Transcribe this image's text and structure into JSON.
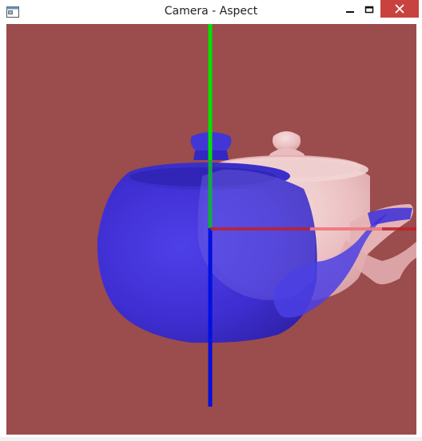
{
  "window": {
    "title": "Camera - Aspect"
  },
  "icons": {
    "app": "window-app-icon",
    "minimize": "minimize-icon",
    "maximize": "maximize-icon",
    "close": "close-icon"
  },
  "colors": {
    "viewport_background": "#9b4c4c",
    "axis_x": "#c0202a",
    "axis_y": "#00e000",
    "axis_z": "#0010e0",
    "teapot_blue": "#3a2fd8",
    "teapot_pink": "#f0c7c9",
    "close_button": "#c8433f"
  }
}
